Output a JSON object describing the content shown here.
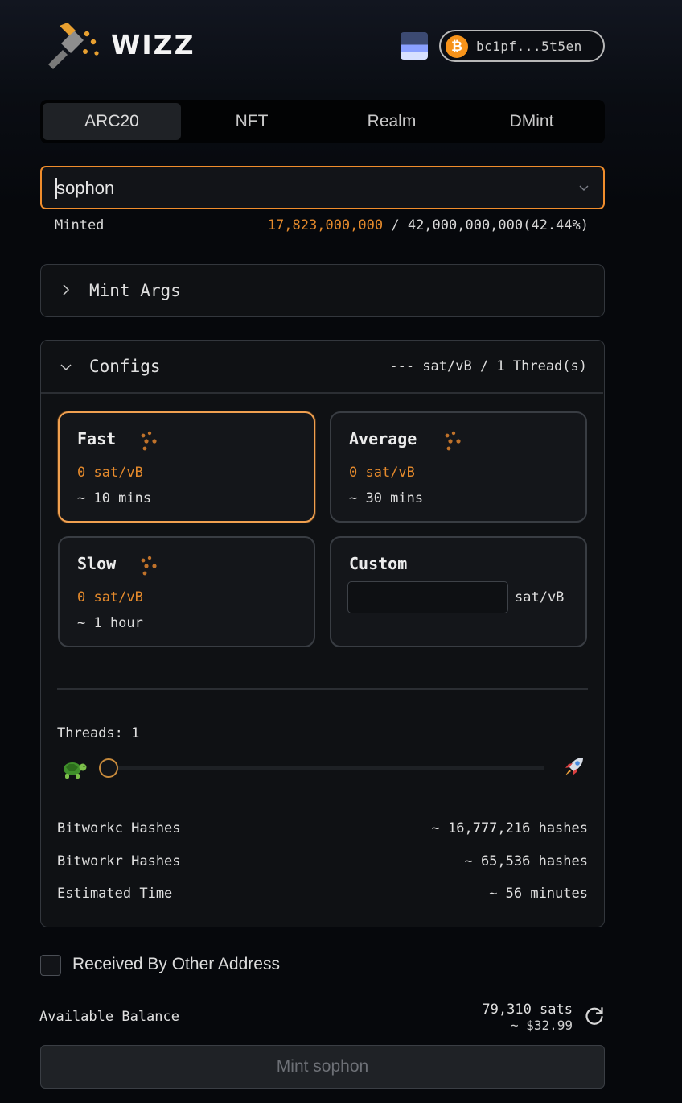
{
  "header": {
    "brand": "WIZZ",
    "address": "bc1pf...5t5en",
    "btc_symbol": "₿"
  },
  "tabs": [
    {
      "label": "ARC20",
      "active": true
    },
    {
      "label": "NFT",
      "active": false
    },
    {
      "label": "Realm",
      "active": false
    },
    {
      "label": "DMint",
      "active": false
    }
  ],
  "token_select": {
    "value": "sophon"
  },
  "minted": {
    "label": "Minted",
    "current": "17,823,000,000",
    "separator": " / ",
    "total": "42,000,000,000(42.44%)"
  },
  "mint_args": {
    "label": "Mint Args",
    "expanded": false
  },
  "configs": {
    "label": "Configs",
    "expanded": true,
    "summary": "--- sat/vB / 1 Thread(s)",
    "fees": [
      {
        "title": "Fast",
        "rate": "0 sat/vB",
        "time": "~ 10 mins",
        "selected": true
      },
      {
        "title": "Average",
        "rate": "0 sat/vB",
        "time": "~ 30 mins",
        "selected": false
      },
      {
        "title": "Slow",
        "rate": "0 sat/vB",
        "time": "~ 1 hour",
        "selected": false
      }
    ],
    "custom": {
      "title": "Custom",
      "unit": "sat/vB",
      "value": ""
    },
    "threads_label": "Threads: 1",
    "threads_value": 1,
    "stats": [
      {
        "label": "Bitworkc Hashes",
        "value": "~ 16,777,216 hashes"
      },
      {
        "label": "Bitworkr Hashes",
        "value": "~ 65,536 hashes"
      },
      {
        "label": "Estimated Time",
        "value": "~ 56 minutes"
      }
    ]
  },
  "receive_other": {
    "label": "Received By Other Address",
    "checked": false
  },
  "balance": {
    "label": "Available Balance",
    "sats": "79,310 sats",
    "usd": "~ $32.99"
  },
  "mint_button": {
    "label": "Mint sophon"
  },
  "colors": {
    "accent": "#f08d2c",
    "background": "#06080c"
  }
}
